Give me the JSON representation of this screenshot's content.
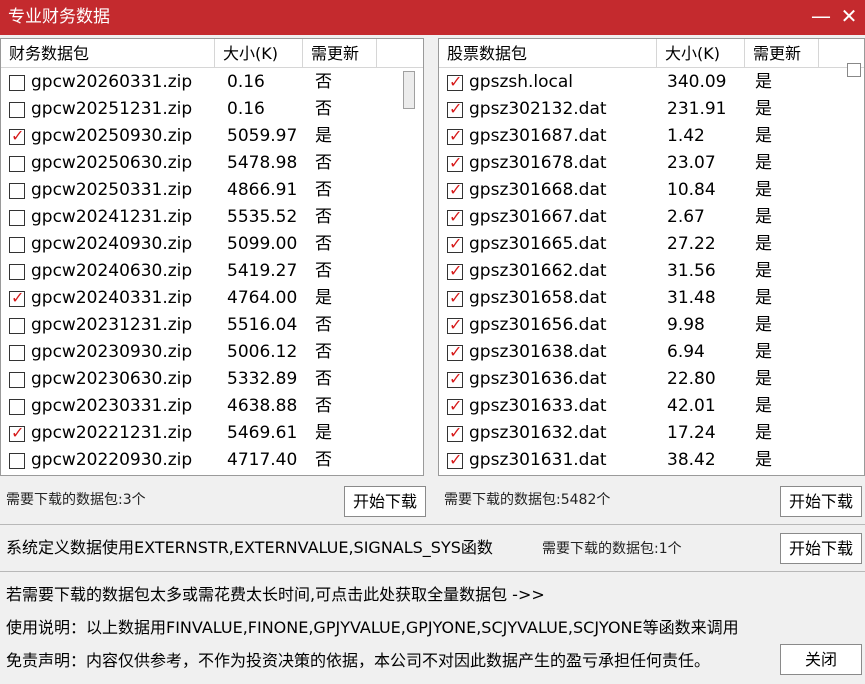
{
  "window": {
    "title": "专业财务数据",
    "minimize_glyph": "—",
    "close_glyph": "✕"
  },
  "left": {
    "columns": [
      "财务数据包",
      "大小(K)",
      "需更新"
    ],
    "rows": [
      {
        "name": "gpcw20260331.zip",
        "size": "0.16",
        "update": "否",
        "checked": false
      },
      {
        "name": "gpcw20251231.zip",
        "size": "0.16",
        "update": "否",
        "checked": false
      },
      {
        "name": "gpcw20250930.zip",
        "size": "5059.97",
        "update": "是",
        "checked": true
      },
      {
        "name": "gpcw20250630.zip",
        "size": "5478.98",
        "update": "否",
        "checked": false
      },
      {
        "name": "gpcw20250331.zip",
        "size": "4866.91",
        "update": "否",
        "checked": false
      },
      {
        "name": "gpcw20241231.zip",
        "size": "5535.52",
        "update": "否",
        "checked": false
      },
      {
        "name": "gpcw20240930.zip",
        "size": "5099.00",
        "update": "否",
        "checked": false
      },
      {
        "name": "gpcw20240630.zip",
        "size": "5419.27",
        "update": "否",
        "checked": false
      },
      {
        "name": "gpcw20240331.zip",
        "size": "4764.00",
        "update": "是",
        "checked": true
      },
      {
        "name": "gpcw20231231.zip",
        "size": "5516.04",
        "update": "否",
        "checked": false
      },
      {
        "name": "gpcw20230930.zip",
        "size": "5006.12",
        "update": "否",
        "checked": false
      },
      {
        "name": "gpcw20230630.zip",
        "size": "5332.89",
        "update": "否",
        "checked": false
      },
      {
        "name": "gpcw20230331.zip",
        "size": "4638.88",
        "update": "否",
        "checked": false
      },
      {
        "name": "gpcw20221231.zip",
        "size": "5469.61",
        "update": "是",
        "checked": true
      },
      {
        "name": "gpcw20220930.zip",
        "size": "4717.40",
        "update": "否",
        "checked": false
      }
    ],
    "status": "需要下载的数据包:3个",
    "button": "开始下载"
  },
  "right": {
    "columns": [
      "股票数据包",
      "大小(K)",
      "需更新"
    ],
    "rows": [
      {
        "name": "gpszsh.local",
        "size": "340.09",
        "update": "是",
        "checked": true
      },
      {
        "name": "gpsz302132.dat",
        "size": "231.91",
        "update": "是",
        "checked": true
      },
      {
        "name": "gpsz301687.dat",
        "size": "1.42",
        "update": "是",
        "checked": true
      },
      {
        "name": "gpsz301678.dat",
        "size": "23.07",
        "update": "是",
        "checked": true
      },
      {
        "name": "gpsz301668.dat",
        "size": "10.84",
        "update": "是",
        "checked": true
      },
      {
        "name": "gpsz301667.dat",
        "size": "2.67",
        "update": "是",
        "checked": true
      },
      {
        "name": "gpsz301665.dat",
        "size": "27.22",
        "update": "是",
        "checked": true
      },
      {
        "name": "gpsz301662.dat",
        "size": "31.56",
        "update": "是",
        "checked": true
      },
      {
        "name": "gpsz301658.dat",
        "size": "31.48",
        "update": "是",
        "checked": true
      },
      {
        "name": "gpsz301656.dat",
        "size": "9.98",
        "update": "是",
        "checked": true
      },
      {
        "name": "gpsz301638.dat",
        "size": "6.94",
        "update": "是",
        "checked": true
      },
      {
        "name": "gpsz301636.dat",
        "size": "22.80",
        "update": "是",
        "checked": true
      },
      {
        "name": "gpsz301633.dat",
        "size": "42.01",
        "update": "是",
        "checked": true
      },
      {
        "name": "gpsz301632.dat",
        "size": "17.24",
        "update": "是",
        "checked": true
      },
      {
        "name": "gpsz301631.dat",
        "size": "38.42",
        "update": "是",
        "checked": true
      }
    ],
    "status": "需要下载的数据包:5482个",
    "button": "开始下载"
  },
  "system": {
    "text": "系统定义数据使用EXTERNSTR,EXTERNVALUE,SIGNALS_SYS函数",
    "status": "需要下载的数据包:1个",
    "button": "开始下载"
  },
  "footer": {
    "link": "若需要下载的数据包太多或需花费太长时间,可点击此处获取全量数据包 ->>",
    "usage": "使用说明：以上数据用FINVALUE,FINONE,GPJYVALUE,GPJYONE,SCJYVALUE,SCJYONE等函数来调用",
    "disclaimer": "免责声明：内容仅供参考，不作为投资决策的依据，本公司不对因此数据产生的盈亏承担任何责任。",
    "close_button": "关闭"
  },
  "colors": {
    "titlebar": "#c42a2e",
    "check": "#d61a1a"
  },
  "scroll": {
    "left_thumb_fraction": 0.1
  }
}
